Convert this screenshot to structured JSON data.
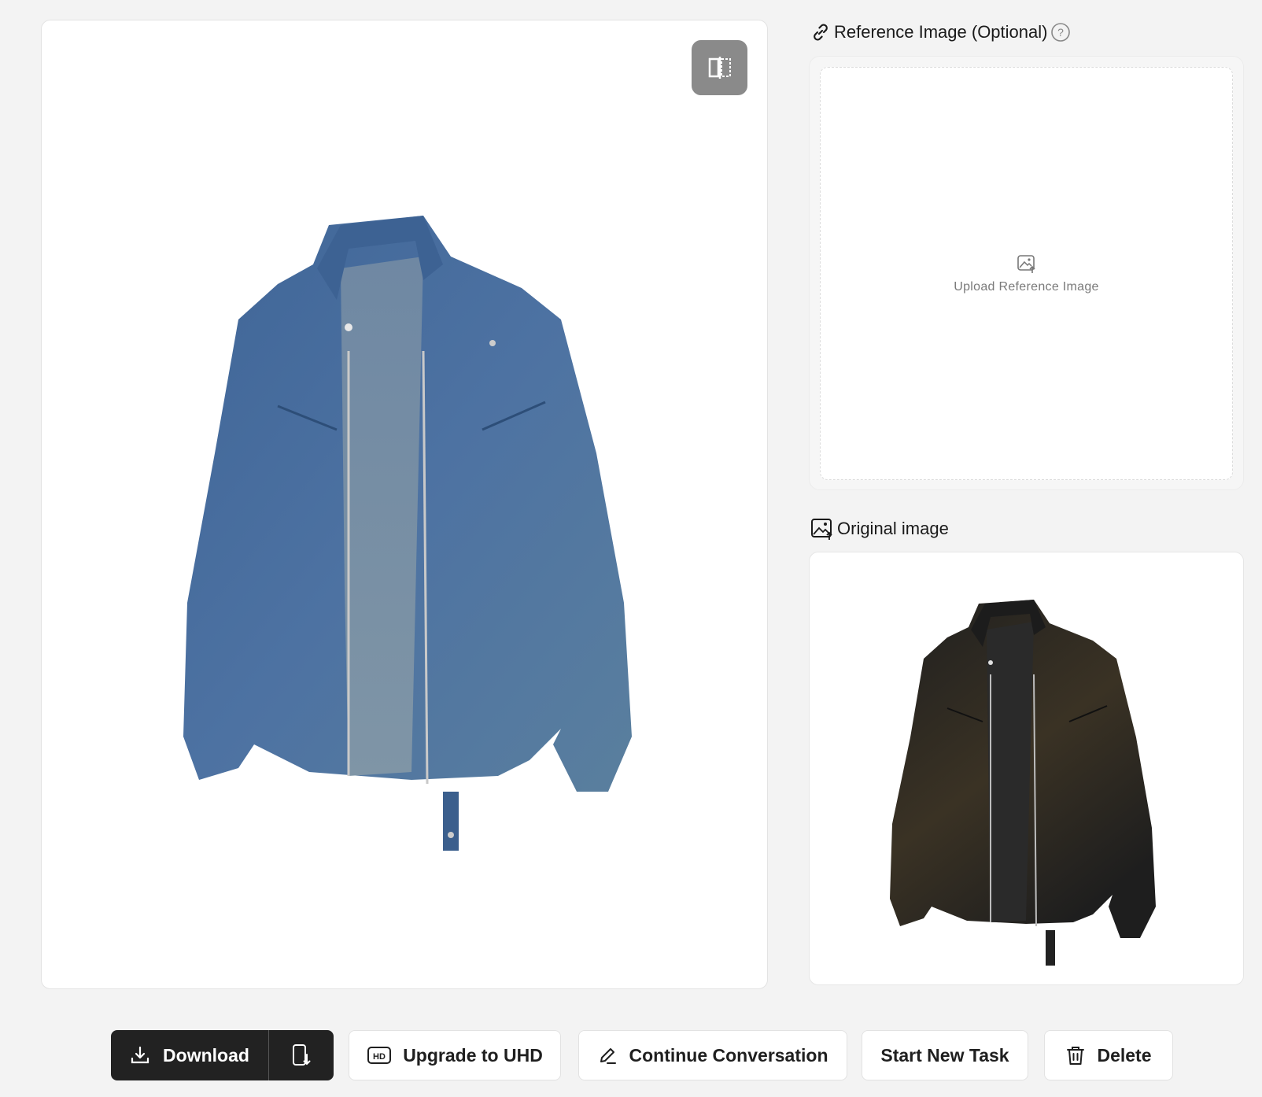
{
  "result": {
    "compare_icon": "compare-split-icon",
    "image_alt": "blue denim jacket"
  },
  "reference": {
    "title": "Reference Image (Optional)",
    "title_icon": "link-icon",
    "help_icon": "question-circle-icon",
    "upload_label": "Upload Reference Image",
    "upload_icon": "image-upload-icon"
  },
  "original": {
    "title": "Original image",
    "title_icon": "image-icon",
    "image_alt": "black washed jacket"
  },
  "actions": {
    "download": "Download",
    "upgrade": "Upgrade to UHD",
    "continue": "Continue Conversation",
    "new_task": "Start New Task",
    "delete": "Delete"
  },
  "colors": {
    "page_bg": "#f3f3f3",
    "dark_button": "#222222",
    "compare_button": "#8a8a8a",
    "denim": "#4a6fa0",
    "black_jacket": "#2a2620"
  }
}
